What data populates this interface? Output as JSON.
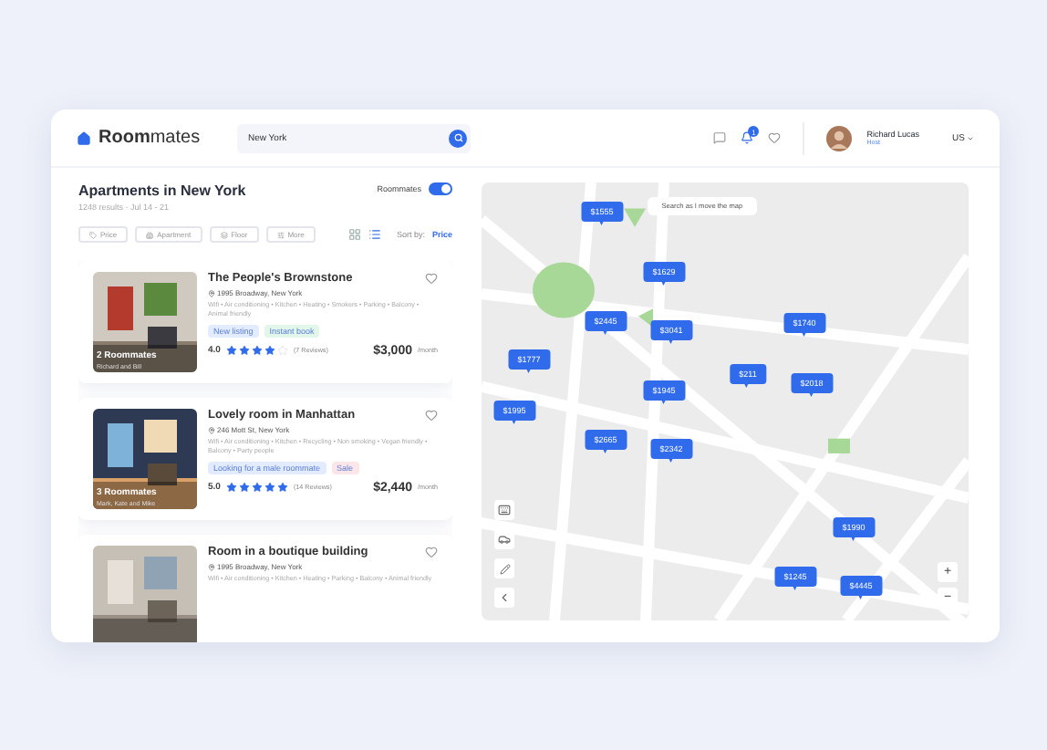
{
  "header": {
    "logo": "**Room**mates",
    "search": {
      "value": "New York"
    },
    "notifications": "1",
    "user": {
      "name": "Richard Lucas",
      "role": "Host"
    },
    "locale": "US"
  },
  "results": {
    "title": "Apartments in New York",
    "subtitle": "1248 results · Jul 14 - 21",
    "roommates_toggle": {
      "label": "Roommates",
      "on": true
    },
    "filters": [
      "Price",
      "Apartment",
      "Floor",
      "More"
    ],
    "views": [
      {
        "kind": "grid",
        "selected": false
      },
      {
        "kind": "list",
        "selected": true
      }
    ],
    "sort": {
      "label": "Sort by:",
      "value": "Price"
    },
    "listings": [
      {
        "title": "The People's Brownstone",
        "address": "1995 Broadway, New York",
        "amenities": "Wifi • Air conditioning • Kitchen • Heating • Smokers • Parking • Balcony • Animal friendly",
        "tags": [
          {
            "text": "New listing",
            "color": "#e3ecff"
          },
          {
            "text": "Instant book",
            "color": "#e2f6ea"
          }
        ],
        "rating": "4.0",
        "stars": 4,
        "reviews": "(7 Reviews)",
        "price": "$3,000",
        "period": "/month",
        "roommates": "2 Roommates",
        "roommate_names": "Richard and Bill",
        "favorite": false
      },
      {
        "title": "Lovely room in Manhattan",
        "address": "246 Mott St, New York",
        "amenities": "Wifi • Air conditioning • Kitchen • Recycling • Non smoking • Vegan friendly • Balcony • Party people",
        "tags": [
          {
            "text": "Looking for a male roommate",
            "color": "#e3ecff"
          },
          {
            "text": "Sale",
            "color": "#fde6ea"
          }
        ],
        "rating": "5.0",
        "stars": 5,
        "reviews": "(14 Reviews)",
        "price": "$2,440",
        "period": "/month",
        "roommates": "3 Roommates",
        "roommate_names": "Mark, Kate and Mike",
        "favorite": false
      },
      {
        "title": "Room in a boutique building",
        "address": "1995 Broadway, New York",
        "amenities": "Wifi • Air conditioning • Kitchen • Heating • Parking • Balcony • Animal friendly",
        "favorite": false
      }
    ]
  },
  "map": {
    "search_toggle": "Search as I move the map",
    "pins": [
      "$1555",
      "$1629",
      "$2445",
      "$3041",
      "$1740",
      "$1777",
      "$211",
      "$2018",
      "$1945",
      "$1995",
      "$2665",
      "$2342",
      "$1990",
      "$1245",
      "$4445"
    ],
    "zoom_in": "+",
    "zoom_out": "−"
  }
}
